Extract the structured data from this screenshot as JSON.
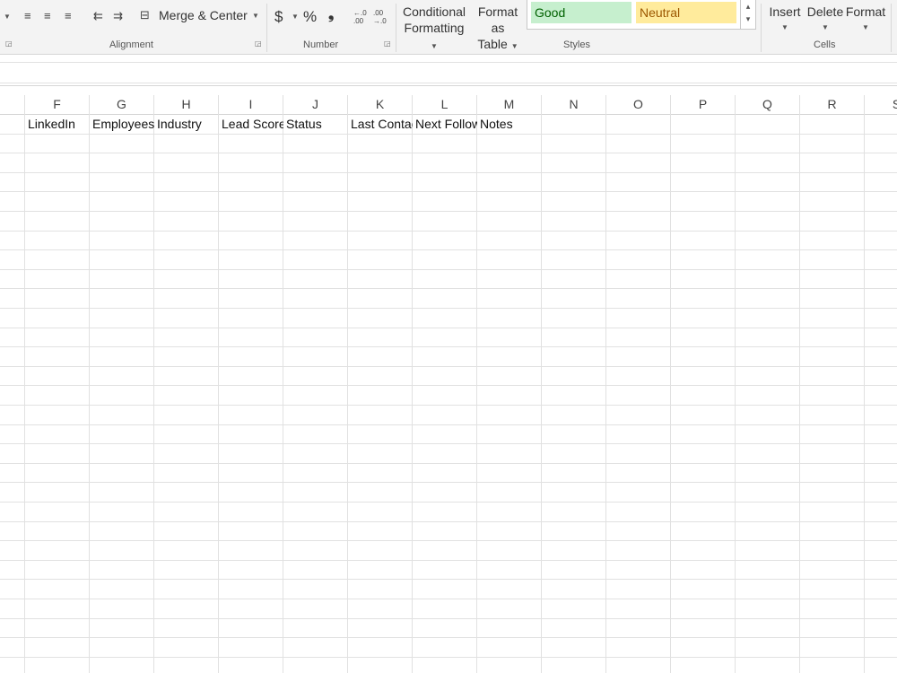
{
  "ribbon": {
    "alignment": {
      "group_label": "Alignment",
      "merge_center_label": "Merge & Center"
    },
    "number": {
      "group_label": "Number",
      "currency_symbol": "$",
      "percent_symbol": "%",
      "comma_symbol": "❟",
      "increase_decimal": "←.0 .00",
      "decrease_decimal": ".00 →.0"
    },
    "styles": {
      "group_label": "Styles",
      "conditional_formatting_line1": "Conditional",
      "conditional_formatting_line2": "Formatting",
      "format_as_table_line1": "Format as",
      "format_as_table_line2": "Table",
      "good_label": "Good",
      "neutral_label": "Neutral",
      "good_bg": "#c6efce",
      "good_fg": "#006100",
      "neutral_bg": "#ffeb9c",
      "neutral_fg": "#9c5700"
    },
    "cells": {
      "group_label": "Cells",
      "insert_label": "Insert",
      "delete_label": "Delete",
      "format_label": "Format"
    }
  },
  "columns": [
    "F",
    "G",
    "H",
    "I",
    "J",
    "K",
    "L",
    "M",
    "N",
    "O",
    "P",
    "Q",
    "R",
    "S"
  ],
  "header_row": [
    "LinkedIn",
    "Employees",
    "Industry",
    "Lead Score",
    "Status",
    "Last Contact",
    "Next Follow",
    "Notes",
    "",
    "",
    "",
    "",
    "",
    ""
  ]
}
